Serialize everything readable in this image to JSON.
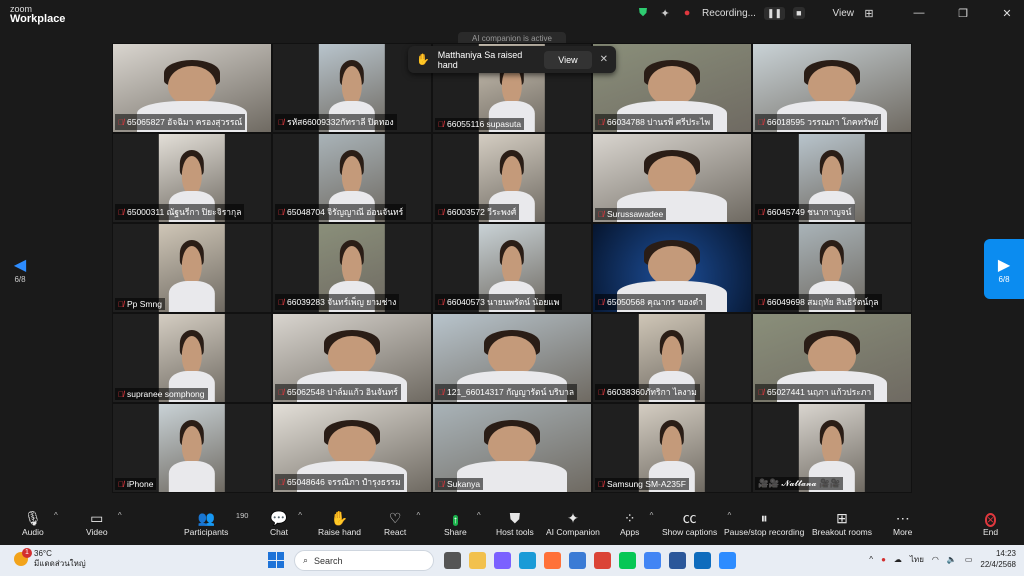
{
  "app": {
    "brand_top": "zoom",
    "brand_bottom": "Workplace"
  },
  "titlebar": {
    "recording_label": "Recording...",
    "view_label": "View",
    "pause_glyph": "❚❚",
    "stop_glyph": "■",
    "grid_glyph": "⊞",
    "min_glyph": "—",
    "max_glyph": "❐",
    "close_glyph": "✕"
  },
  "ai_hint": "AI companion is active",
  "toast": {
    "hand_glyph": "✋",
    "message": "Matthaniya Sa raised hand",
    "view_button": "View",
    "close": "✕"
  },
  "pager": {
    "left_label": "6/8",
    "right_label": "6/8",
    "left_arrow": "◀",
    "right_arrow": "▶"
  },
  "participants": [
    {
      "name": "65065827 อัจฉิมา ครองสุวรรณ์",
      "muted": true,
      "fit": "narrow"
    },
    {
      "name": "รหัส66009332กัทราลี ปิดทอง",
      "muted": true,
      "fit": "xnarrow"
    },
    {
      "name": "66055116 supasuta",
      "muted": true,
      "fit": "xnarrow"
    },
    {
      "name": "66034788 ปานรพี ศรีประไพ",
      "muted": true,
      "fit": "wide"
    },
    {
      "name": "66018595 วรรณภา โภคทรัพย์",
      "muted": true,
      "fit": "wide"
    },
    {
      "name": "65000311 ณัฐนรีกา ปิยะจิรากุล",
      "muted": true,
      "fit": "xnarrow"
    },
    {
      "name": "65048704 จิรัญญาณี อ่อนจันทร์",
      "muted": true,
      "fit": "xnarrow"
    },
    {
      "name": "66003572 วีระพงศ์",
      "muted": true,
      "fit": "xnarrow"
    },
    {
      "name": "Surussawadee",
      "muted": true,
      "fit": "wide"
    },
    {
      "name": "66045749 ชนากาญจน์",
      "muted": true,
      "fit": "xnarrow"
    },
    {
      "name": "Pp Smng",
      "muted": true,
      "fit": "xnarrow"
    },
    {
      "name": "66039283 จันทร์เพ็ญ ยามช่าง",
      "muted": true,
      "fit": "xnarrow"
    },
    {
      "name": "66040573 นายนพรัตน์ น้อยแพ",
      "muted": true,
      "fit": "xnarrow"
    },
    {
      "name": "65050568 คุณากร ของดำ",
      "muted": true,
      "fit": "wide"
    },
    {
      "name": "66049698 สมฤทัย สินธิรัตน์กุล",
      "muted": true,
      "fit": "xnarrow"
    },
    {
      "name": "supranee somphong",
      "muted": true,
      "fit": "xnarrow"
    },
    {
      "name": "65062548 ปาล์มแก้ว อินจันทร์",
      "muted": true,
      "fit": "wide"
    },
    {
      "name": "121_66014317 กัญญารัตน์ บริบาล",
      "muted": true,
      "fit": "wide"
    },
    {
      "name": "66038360ภัทริกา ไลงาม",
      "muted": true,
      "fit": "xnarrow"
    },
    {
      "name": "65027441 นฤภา แก้วประภา",
      "muted": true,
      "fit": "wide"
    },
    {
      "name": "iPhone",
      "muted": true,
      "fit": "xnarrow"
    },
    {
      "name": "65048646 จรรณิภา ปำรุงธรรม",
      "muted": true,
      "fit": "wide"
    },
    {
      "name": "Sukanya",
      "muted": true,
      "fit": "wide"
    },
    {
      "name": "Samsung SM-A235F",
      "muted": true,
      "fit": "xnarrow"
    },
    {
      "name": "🎥🎥 𝓝𝓪𝓽𝓽𝓪𝓷𝓪 🎥🎥",
      "muted": false,
      "fit": "xnarrow"
    }
  ],
  "toolbar": {
    "audio": "Audio",
    "video": "Video",
    "participants": "Participants",
    "participants_count": "190",
    "chat": "Chat",
    "raise_hand": "Raise hand",
    "react": "React",
    "share": "Share",
    "host_tools": "Host tools",
    "ai_companion": "AI Companion",
    "apps": "Apps",
    "captions": "Show captions",
    "recording": "Pause/stop recording",
    "breakout": "Breakout rooms",
    "more": "More",
    "end": "End",
    "caret": "^"
  },
  "taskbar": {
    "temperature": "36°C",
    "weather_desc": "มีแดดส่วนใหญ่",
    "notify_count": "1",
    "search_placeholder": "Search",
    "lang": "ไทย",
    "time": "14:23",
    "date": "22/4/2568"
  }
}
